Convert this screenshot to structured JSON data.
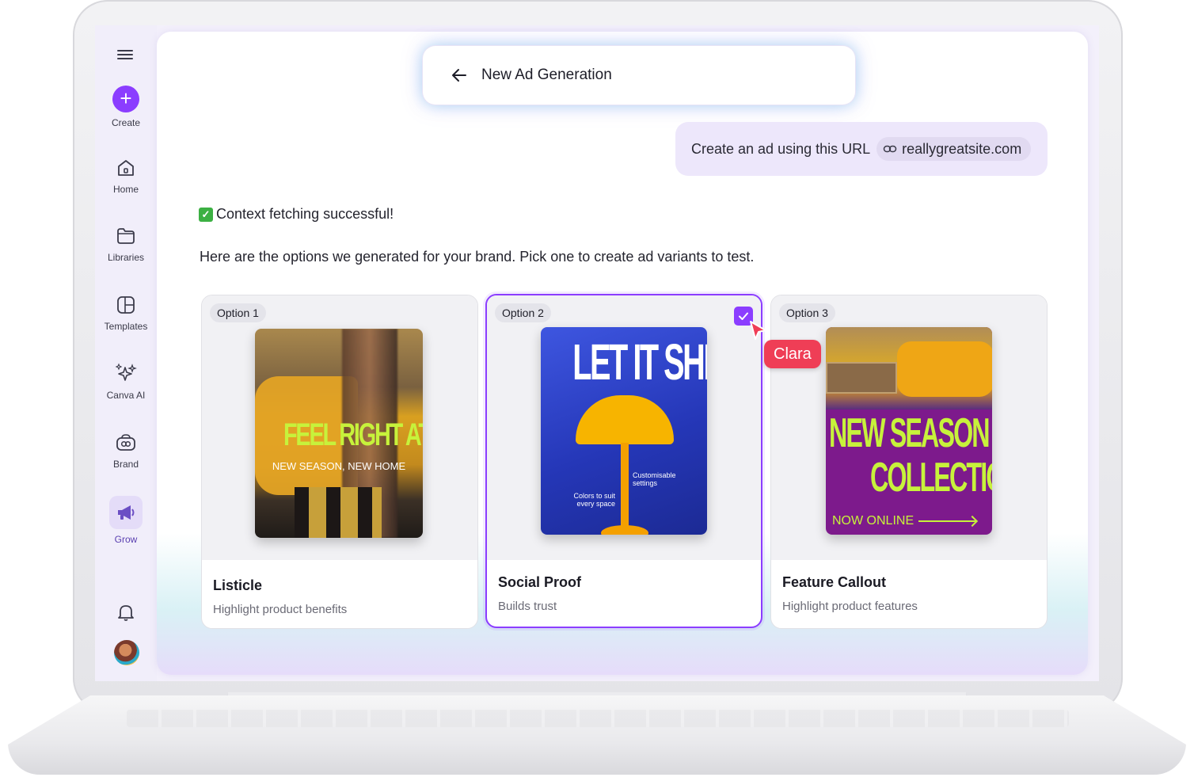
{
  "sidebar": {
    "items": [
      {
        "label": "Create"
      },
      {
        "label": "Home"
      },
      {
        "label": "Libraries"
      },
      {
        "label": "Templates"
      },
      {
        "label": "Canva AI"
      },
      {
        "label": "Brand"
      },
      {
        "label": "Grow"
      }
    ]
  },
  "header": {
    "title": "New Ad Generation"
  },
  "chat": {
    "user_message": "Create an ad using this URL",
    "url": "reallygreatsite.com",
    "status": "Context fetching successful!",
    "intro": "Here are the options we generated for your brand. Pick one to create ad variants to test."
  },
  "options": [
    {
      "tag": "Option 1",
      "title": "Listicle",
      "subtitle": "Highlight product benefits",
      "thumb_headline": "FEEL RIGHT AT HOME",
      "thumb_sub": "NEW SEASON, NEW HOME",
      "selected": false
    },
    {
      "tag": "Option 2",
      "title": "Social Proof",
      "subtitle": "Builds trust",
      "thumb_headline": "LET IT SHINE",
      "thumb_caption_1": "Customisable settings",
      "thumb_caption_2": "Colors to suit every space",
      "selected": true
    },
    {
      "tag": "Option 3",
      "title": "Feature Callout",
      "subtitle": "Highlight product features",
      "thumb_headline_1": "NEW SEASON",
      "thumb_headline_2": "COLLECTION",
      "thumb_sub": "NOW ONLINE",
      "selected": false
    }
  ],
  "collaborator": {
    "name": "Clara"
  },
  "colors": {
    "accent": "#8b3dff",
    "cursor": "#ef3e56",
    "lime": "#c7f23b"
  },
  "icons": [
    "menu-icon",
    "plus-icon",
    "home-icon",
    "folder-icon",
    "templates-icon",
    "sparkle-icon",
    "brand-icon",
    "megaphone-icon",
    "bell-icon",
    "back-arrow-icon",
    "link-icon",
    "check-icon",
    "cursor-icon"
  ]
}
